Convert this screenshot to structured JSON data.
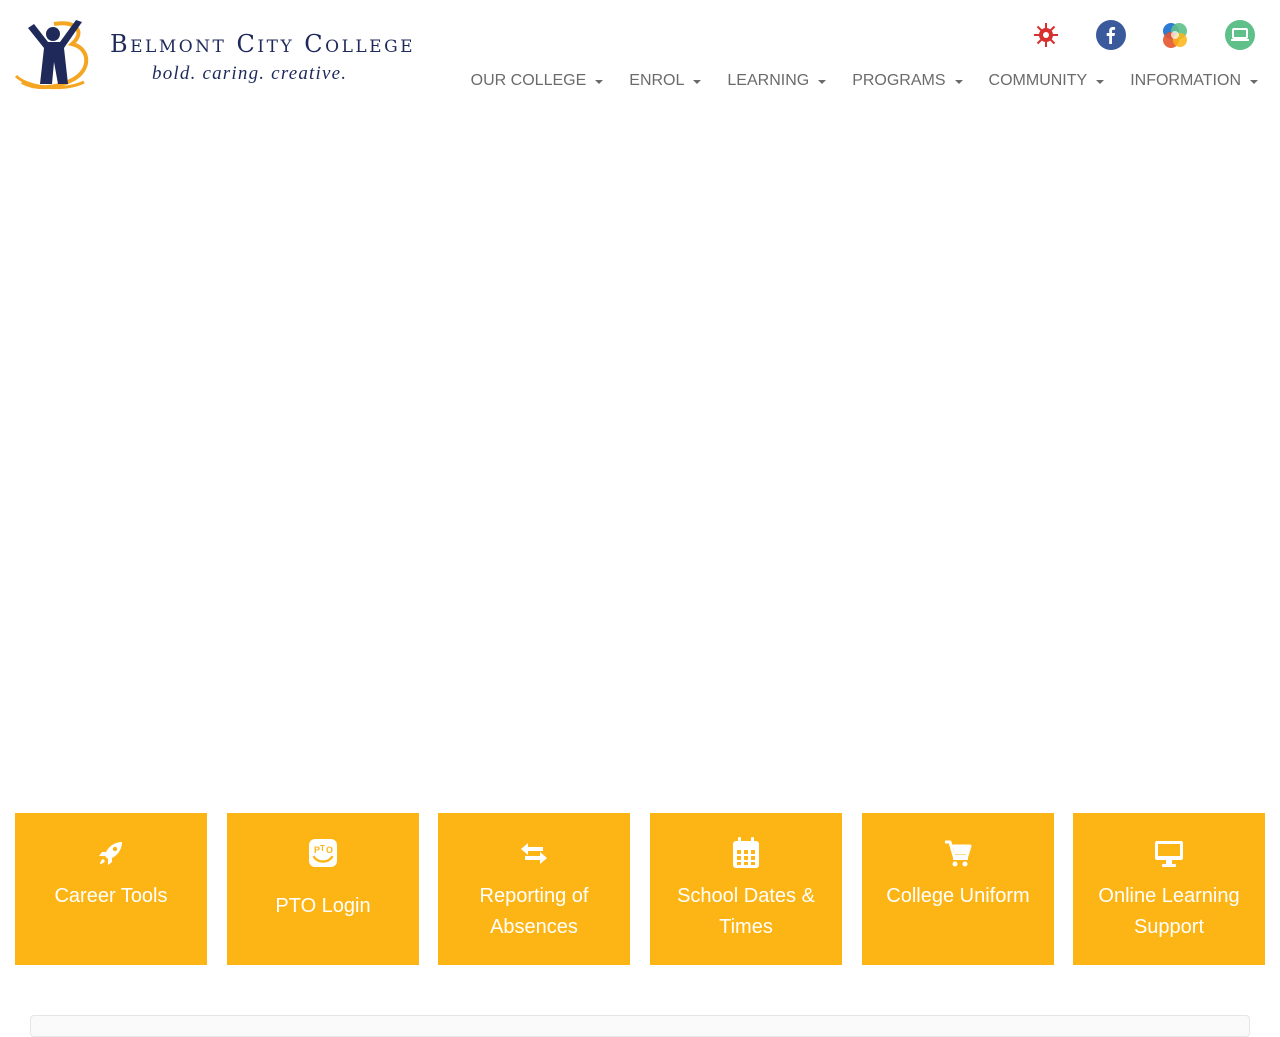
{
  "logo": {
    "name": "Belmont City College",
    "tagline": "bold. caring. creative."
  },
  "social": [
    {
      "name": "virus-icon",
      "color": "#d8302e"
    },
    {
      "name": "facebook-icon",
      "color": "#3b5a9b"
    },
    {
      "name": "connect-icon",
      "color": "#e4572e"
    },
    {
      "name": "laptop-icon",
      "color": "#5fc08a"
    }
  ],
  "nav": {
    "items": [
      {
        "label": "OUR COLLEGE"
      },
      {
        "label": "ENROL"
      },
      {
        "label": "LEARNING"
      },
      {
        "label": "PROGRAMS"
      },
      {
        "label": "COMMUNITY"
      },
      {
        "label": "INFORMATION"
      }
    ]
  },
  "tiles": [
    {
      "label": "Career Tools",
      "icon": "rocket-icon"
    },
    {
      "label": "PTO Login",
      "icon": "pto-icon"
    },
    {
      "label": "Reporting of Absences",
      "icon": "exchange-icon"
    },
    {
      "label": "School Dates & Times",
      "icon": "calendar-icon"
    },
    {
      "label": "College Uniform",
      "icon": "cart-icon"
    },
    {
      "label": "Online Learning Support",
      "icon": "desktop-icon"
    }
  ],
  "colors": {
    "tile_background": "#fdb515",
    "brand_navy": "#1f2a5a",
    "nav_text": "#6b6b6b"
  }
}
